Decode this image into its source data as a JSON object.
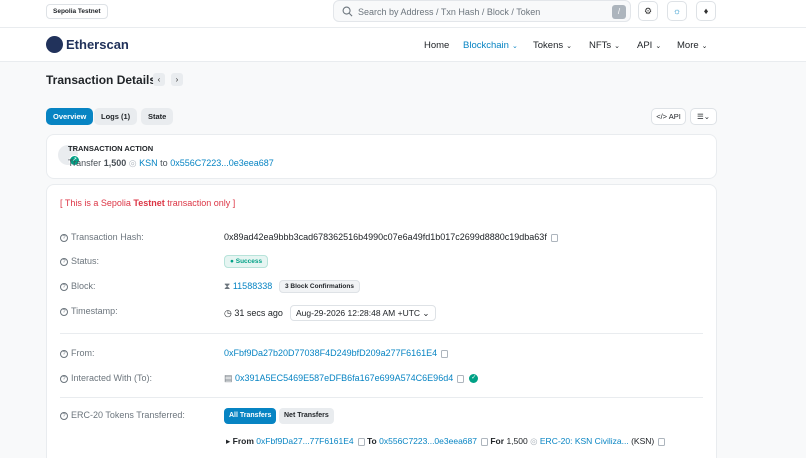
{
  "topbar": {
    "network": "Sepolia Testnet",
    "search_placeholder": "Search by Address / Txn Hash / Block / Token",
    "search_shortcut": "/"
  },
  "nav": {
    "brand": "Etherscan",
    "items": [
      "Home",
      "Blockchain",
      "Tokens",
      "NFTs",
      "API",
      "More"
    ]
  },
  "page": {
    "title": "Transaction Details",
    "prev": "‹",
    "next": "›",
    "tabs": [
      "Overview",
      "Logs (1)",
      "State"
    ],
    "api_btn": "API"
  },
  "action": {
    "title": "TRANSACTION ACTION",
    "verb": "Transfer",
    "amount": "1,500",
    "token": "KSN",
    "to_word": "to",
    "to_address": "0x556C7223...0e3eea687"
  },
  "details": {
    "testnet_prefix": "[ This is a Sepolia ",
    "testnet_word": "Testnet",
    "testnet_suffix": " transaction only ]",
    "labels": {
      "hash": "Transaction Hash:",
      "status": "Status:",
      "block": "Block:",
      "timestamp": "Timestamp:",
      "from": "From:",
      "interacted": "Interacted With (To):",
      "erc20": "ERC-20 Tokens Transferred:"
    },
    "hash": "0x89ad42ea9bbb3cad678362516b4990c07e6a49fd1b017c2699d8880c19dba63f",
    "status": "Success",
    "block": "11588338",
    "confirmations": "3 Block Confirmations",
    "ago": "31 secs ago",
    "timestamp": "Aug-29-2026 12:28:48 AM +UTC",
    "from": "0xFbf9Da27b20D77038F4D249bfD209a277F6161E4",
    "to": "0x391A5EC5469E587eDFB6fa167e699A574C6E96d4",
    "transfer_tabs": [
      "All Transfers",
      "Net Transfers"
    ],
    "transfer": {
      "from_word": "From",
      "from_addr": "0xFbf9Da27...77F6161E4",
      "to_word": "To",
      "to_addr": "0x556C7223...0e3eea687",
      "for_word": "For",
      "amount": "1,500",
      "token_name": "ERC-20: KSN Civiliza...",
      "token_symbol": "(KSN)"
    }
  },
  "colors": {
    "accent": "#0784c3",
    "success": "#00a186",
    "danger": "#dc3545"
  }
}
